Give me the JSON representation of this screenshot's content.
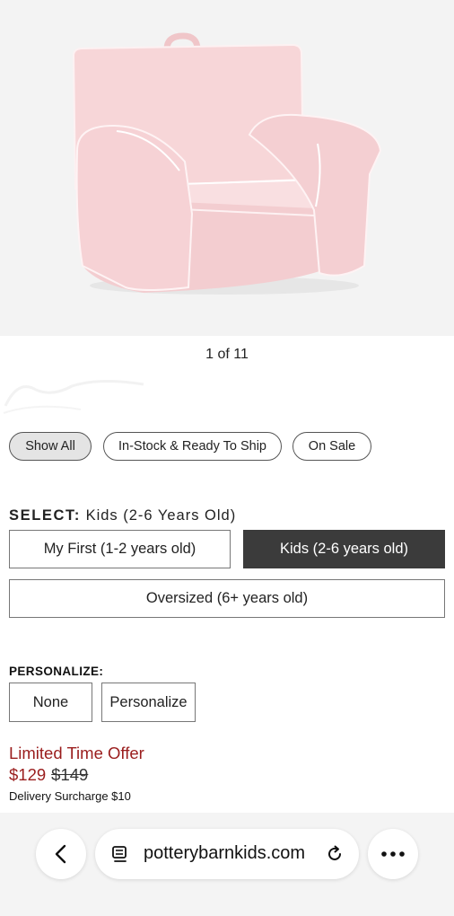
{
  "gallery": {
    "counter": "1 of 11",
    "image_alt": "Pink kids anywhere chair with white piping"
  },
  "filters": {
    "chips": [
      {
        "label": "Show All",
        "active": true
      },
      {
        "label": "In-Stock & Ready To Ship",
        "active": false
      },
      {
        "label": "On Sale",
        "active": false
      }
    ]
  },
  "select": {
    "label": "SELECT:",
    "value": "Kids (2-6 Years Old)",
    "options": [
      {
        "label": "My First (1-2 years old)",
        "selected": false
      },
      {
        "label": "Kids (2-6 years old)",
        "selected": true
      },
      {
        "label": "Oversized (6+ years old)",
        "selected": false
      }
    ]
  },
  "personalize": {
    "label": "PERSONALIZE:",
    "options": [
      {
        "label": "None"
      },
      {
        "label": "Personalize"
      }
    ]
  },
  "pricing": {
    "promo": "Limited Time Offer",
    "sale_price": "$129",
    "original_price": "$149",
    "surcharge": "Delivery Surcharge $10"
  },
  "browser": {
    "url": "potterybarnkids.com",
    "back_icon": "chevron-left-icon",
    "reader_icon": "reader-mode-icon",
    "reload_icon": "reload-icon",
    "more_icon": "more-icon"
  },
  "colors": {
    "accent_red": "#9a1d1d",
    "selected_bg": "#3b3b3b",
    "chair_pink": "#f7d6d8"
  }
}
